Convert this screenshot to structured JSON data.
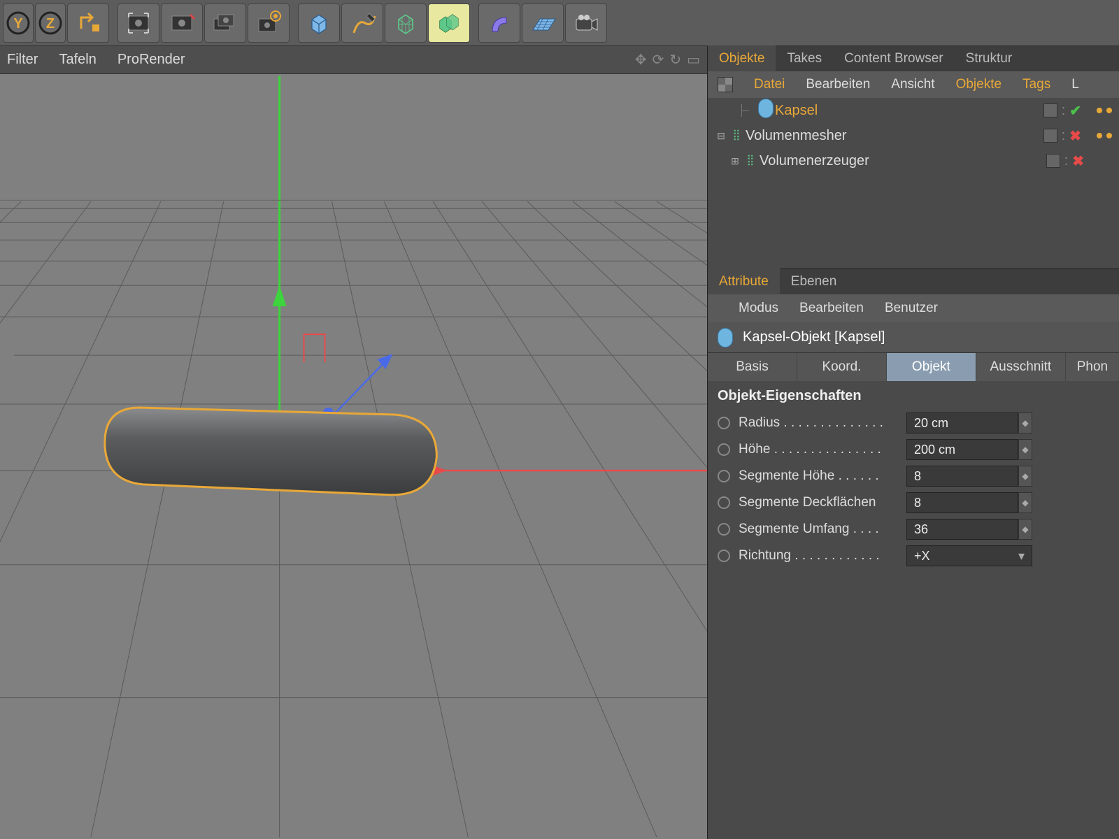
{
  "toolbar": {
    "axis_y": "Y",
    "axis_z": "Z"
  },
  "viewport_menu": {
    "filter": "Filter",
    "panels": "Tafeln",
    "renderer": "ProRender"
  },
  "objects_panel": {
    "tabs": {
      "objects": "Objekte",
      "takes": "Takes",
      "content": "Content Browser",
      "structure": "Struktur"
    },
    "submenu": {
      "file": "Datei",
      "edit": "Bearbeiten",
      "view": "Ansicht",
      "objects": "Objekte",
      "tags": "Tags",
      "more": "L"
    },
    "tree": [
      {
        "name": "Kapsel",
        "selected": true,
        "indent": 1,
        "icon": "capsule",
        "check": "✔",
        "check_color": "#4ac24a",
        "dots": true
      },
      {
        "name": "Volumenmesher",
        "selected": false,
        "indent": 0,
        "icon": "vol-green",
        "exp": "⊟",
        "check": "✖",
        "check_color": "#d44",
        "dots": true
      },
      {
        "name": "Volumenerzeuger",
        "selected": false,
        "indent": 1,
        "icon": "vol-green",
        "exp": "⊞",
        "check": "✖",
        "check_color": "#d44",
        "dots": false
      }
    ]
  },
  "attribute_panel": {
    "tabs": {
      "attribute": "Attribute",
      "layers": "Ebenen"
    },
    "submenu": {
      "mode": "Modus",
      "edit": "Bearbeiten",
      "user": "Benutzer"
    },
    "header": "Kapsel-Objekt [Kapsel]",
    "subtabs": {
      "basis": "Basis",
      "koord": "Koord.",
      "objekt": "Objekt",
      "ausschnitt": "Ausschnitt",
      "phong": "Phon"
    },
    "section_title": "Objekt-Eigenschaften",
    "props": [
      {
        "label": "Radius",
        "value": "20 cm",
        "type": "num"
      },
      {
        "label": "Höhe",
        "value": "200 cm",
        "type": "num"
      },
      {
        "label": "Segmente Höhe",
        "value": "8",
        "type": "num"
      },
      {
        "label": "Segmente Deckflächen",
        "value": "8",
        "type": "num"
      },
      {
        "label": "Segmente Umfang",
        "value": "36",
        "type": "num"
      },
      {
        "label": "Richtung",
        "value": "+X",
        "type": "drop"
      }
    ]
  }
}
